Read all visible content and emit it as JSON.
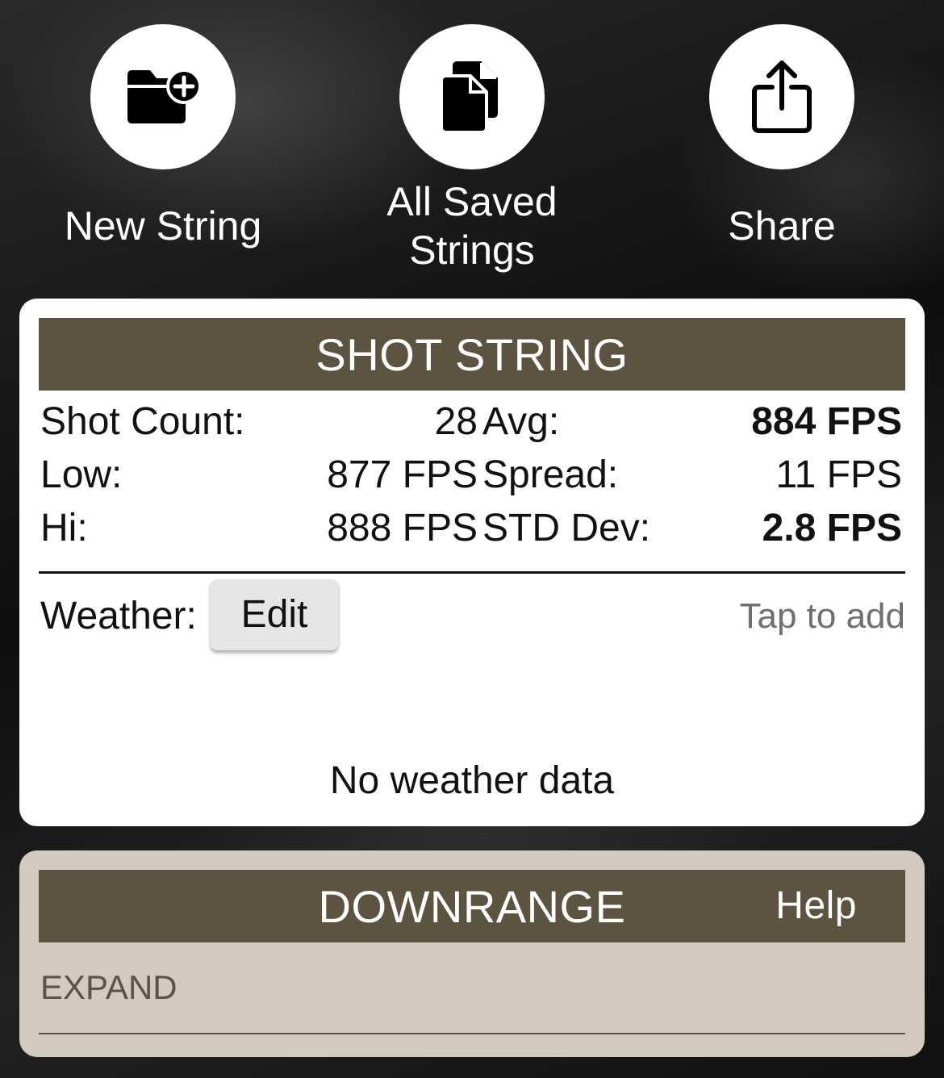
{
  "actions": {
    "new_string": {
      "label": "New String",
      "icon": "folder-add-icon"
    },
    "all_saved": {
      "label_line1": "All Saved",
      "label_line2": "Strings",
      "icon": "documents-copy-icon"
    },
    "share": {
      "label": "Share",
      "icon": "share-icon"
    }
  },
  "shot_string": {
    "title": "SHOT STRING",
    "stats": [
      {
        "label1": "Shot Count:",
        "value1": "28",
        "label2": "Avg:",
        "value2": "884 FPS"
      },
      {
        "label1": "Low:",
        "value1": "877 FPS",
        "label2": "Spread:",
        "value2": "11 FPS"
      },
      {
        "label1": "Hi:",
        "value1": "888 FPS",
        "label2": "STD Dev:",
        "value2": "2.8 FPS"
      }
    ],
    "weather": {
      "label": "Weather:",
      "edit_label": "Edit",
      "tap_hint": "Tap to add",
      "empty_text": "No weather data"
    }
  },
  "downrange": {
    "title": "DOWNRANGE",
    "help_label": "Help",
    "expand_label": "EXPAND"
  },
  "colors": {
    "header_bg": "#5c5340",
    "downrange_card_bg": "#d3c9bf",
    "card_bg": "#ffffff"
  }
}
